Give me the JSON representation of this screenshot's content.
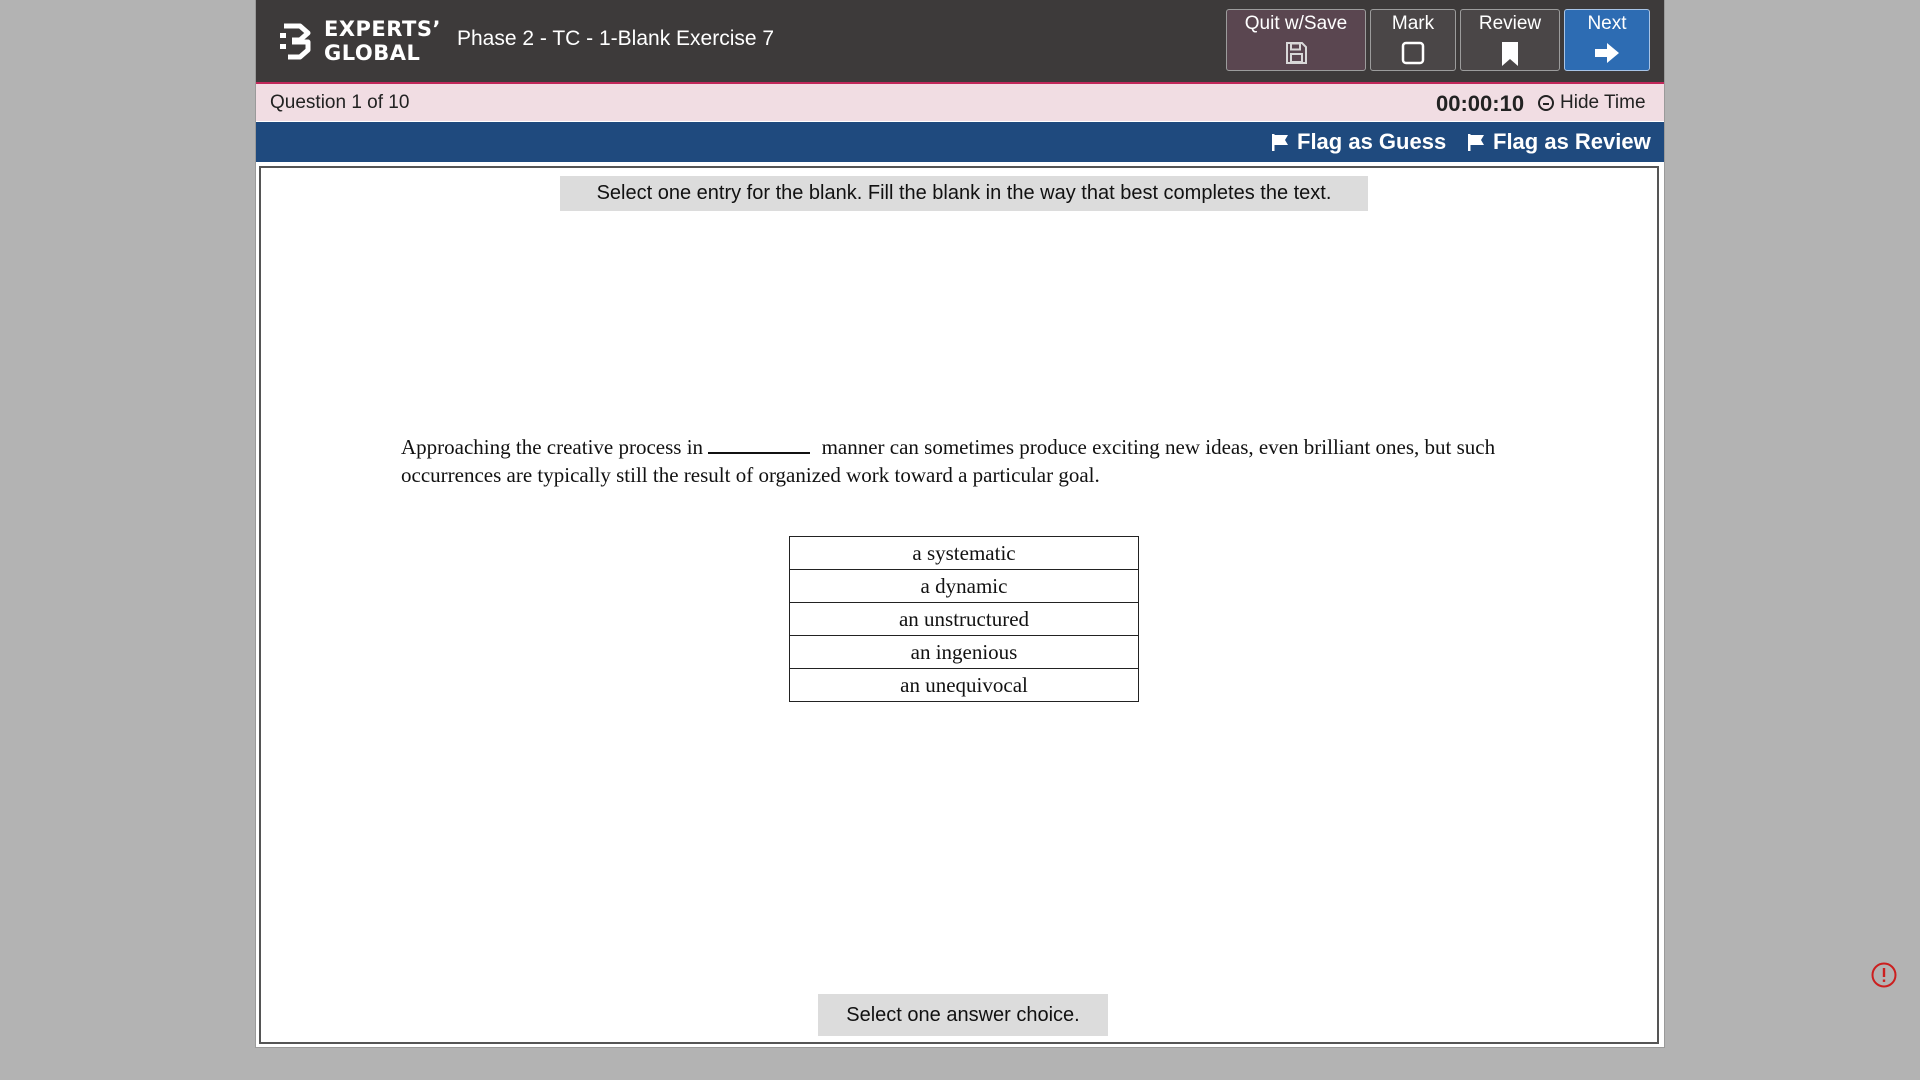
{
  "header": {
    "logo_line1": "EXPERTS’",
    "logo_line2": "GLOBAL",
    "exam_title": "Phase 2 - TC - 1-Blank Exercise 7",
    "buttons": {
      "quit": "Quit w/Save",
      "mark": "Mark",
      "review": "Review",
      "next": "Next"
    }
  },
  "status": {
    "question": "Question 1 of 10",
    "timer": "00:00:10",
    "hide_time": "Hide Time"
  },
  "flags": {
    "guess": "Flag as Guess",
    "review": "Flag as Review"
  },
  "question": {
    "instruction": "Select one entry for the blank. Fill the blank in the way that best completes the text.",
    "passage_before": "Approaching the creative process in",
    "passage_after": "manner can sometimes produce exciting new ideas, even brilliant ones, but such occurrences are typically still the result of organized work toward a particular goal.",
    "choices": [
      "a systematic",
      "a dynamic",
      "an unstructured",
      "an ingenious",
      "an unequivocal"
    ],
    "footer_hint": "Select one answer choice."
  },
  "icons": {
    "quit": "save-icon",
    "mark": "checkbox-icon",
    "review": "bookmark-icon",
    "next": "arrow-right-icon",
    "flag": "flag-icon",
    "alert": "alert-circle-icon"
  },
  "colors": {
    "header_bg": "#3d3a3a",
    "accent_line": "#c1285a",
    "question_bar": "#f1dde3",
    "flag_bar": "#1f4a7e",
    "next_button": "#2d6cb3",
    "alert": "#cc1f1f"
  }
}
